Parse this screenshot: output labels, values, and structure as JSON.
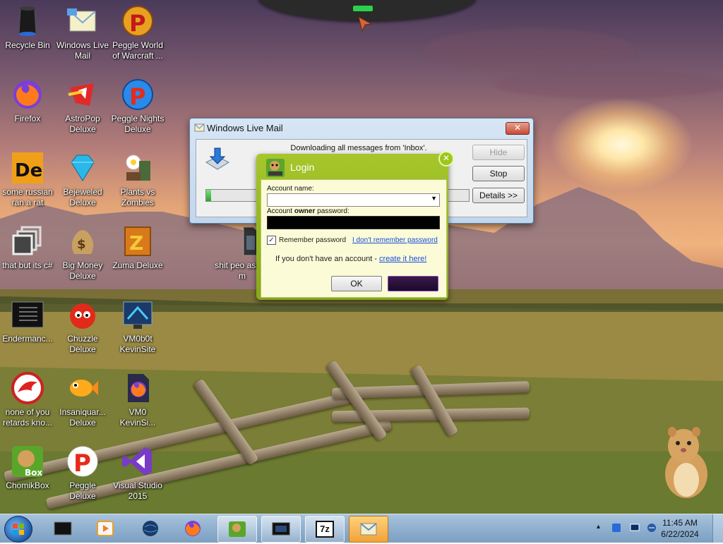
{
  "desktop": {
    "icons": [
      {
        "label": "Recycle Bin",
        "icon": "recycle-bin-icon"
      },
      {
        "label": "Windows Live Mail",
        "icon": "windows-live-mail-icon"
      },
      {
        "label": "Peggle World of Warcraft ...",
        "icon": "peggle-wow-icon"
      },
      {
        "label": "Firefox",
        "icon": "firefox-icon"
      },
      {
        "label": "AstroPop Deluxe",
        "icon": "astropop-icon"
      },
      {
        "label": "Peggle Nights Deluxe",
        "icon": "peggle-nights-icon"
      },
      {
        "label": "some russian ran a rat",
        "icon": "de-icon"
      },
      {
        "label": "Bejeweled Deluxe",
        "icon": "bejeweled-icon"
      },
      {
        "label": "Plants vs Zombies",
        "icon": "plants-vs-zombies-icon"
      },
      {
        "label": "that but its c#",
        "icon": "stacked-windows-icon"
      },
      {
        "label": "Big Money Deluxe",
        "icon": "money-bag-icon"
      },
      {
        "label": "Zuma Deluxe",
        "icon": "zuma-icon"
      },
      {
        "label": "shit peo asked m",
        "icon": "file-icon"
      },
      {
        "label": "Endermanc...",
        "icon": "terminal-icon"
      },
      {
        "label": "Chuzzle Deluxe",
        "icon": "chuzzle-icon"
      },
      {
        "label": "VM0b0t KevinSite",
        "icon": "vm-icon"
      },
      {
        "label": "none of you retards kno...",
        "icon": "red-circle-icon"
      },
      {
        "label": "Insaniquar... Deluxe",
        "icon": "fish-icon"
      },
      {
        "label": "VM0 KevinSi...",
        "icon": "firefox-file-icon"
      },
      {
        "label": "ChomikBox",
        "icon": "chomikbox-icon"
      },
      {
        "label": "Peggle Deluxe",
        "icon": "peggle-icon"
      },
      {
        "label": "Visual Studio 2015",
        "icon": "visual-studio-icon"
      }
    ]
  },
  "wlm_window": {
    "title": "Windows Live Mail",
    "close_label": "✕",
    "status": "Downloading all messages from 'Inbox'.",
    "hide_label": "Hide",
    "stop_label": "Stop",
    "details_label": "Details >>",
    "progress_fraction": 0.02
  },
  "login": {
    "title": "Login",
    "close_label": "✕",
    "account_name_label": "Account name:",
    "account_name_value": "",
    "password_label_prefix": "Account ",
    "password_label_bold": "owner",
    "password_label_suffix": " password:",
    "remember_label": "Remember password",
    "remember_checked": true,
    "forgot_link": "I don't remember password",
    "no_account_text": "If you don't have an account - ",
    "create_link": "create it here!",
    "ok_label": "OK",
    "second_button_label": ""
  },
  "taskbar": {
    "items": [
      {
        "name": "taskbar-terminal",
        "icon": "terminal-icon"
      },
      {
        "name": "taskbar-media",
        "icon": "media-player-icon"
      },
      {
        "name": "taskbar-globe",
        "icon": "globe-icon"
      },
      {
        "name": "taskbar-firefox",
        "icon": "firefox-icon"
      },
      {
        "name": "taskbar-chomikbox",
        "icon": "chomikbox-icon"
      },
      {
        "name": "taskbar-screen",
        "icon": "monitor-icon"
      },
      {
        "name": "taskbar-7zip",
        "icon": "7zip-icon",
        "text": "7z"
      },
      {
        "name": "taskbar-wlm",
        "icon": "windows-live-mail-icon"
      }
    ],
    "tray": {
      "time": "11:45 AM",
      "date": "6/22/2024",
      "show_hidden_label": "▴"
    }
  },
  "colors": {
    "login_green": "#9cc61c",
    "login_body": "#fcfbd8",
    "taskbar_blue": "#8fb0cf",
    "link_blue": "#1a4ed8",
    "progress_green": "#2aa52a"
  }
}
